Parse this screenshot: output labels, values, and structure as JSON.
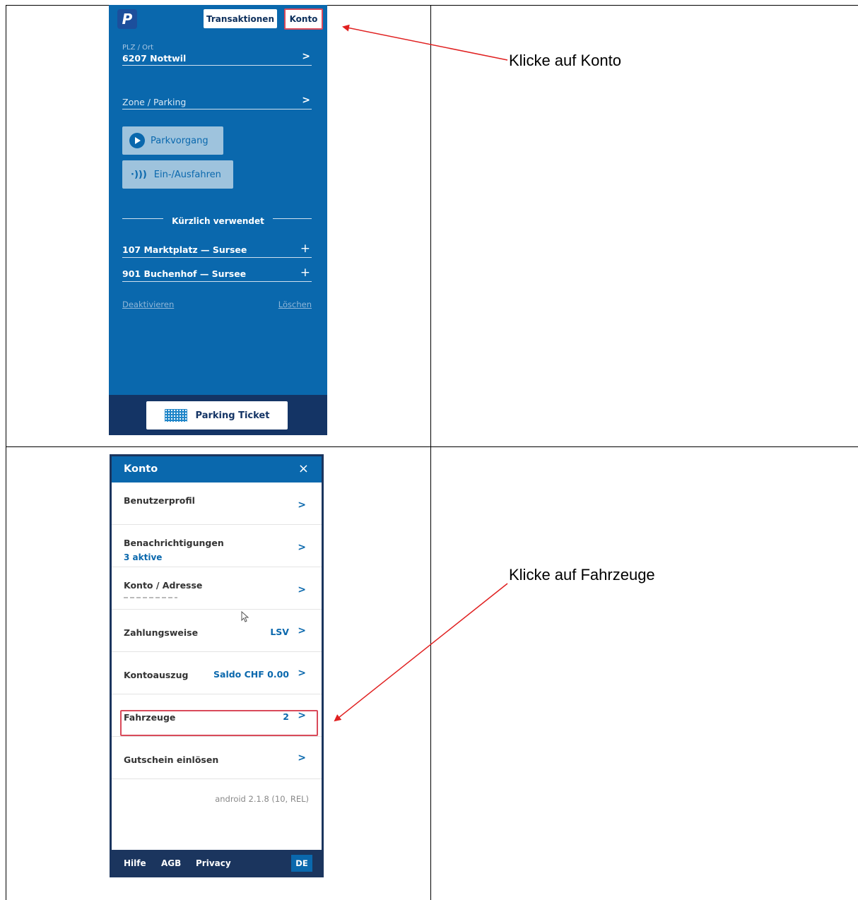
{
  "screen1": {
    "logo_letter": "P",
    "header": {
      "transactions_label": "Transaktionen",
      "account_label": "Konto"
    },
    "location": {
      "label": "PLZ / Ort",
      "value": "6207 Nottwil"
    },
    "zone": {
      "label": "Zone / Parking"
    },
    "actions": {
      "parking_label": "Parkvorgang",
      "entry_exit_label": "Ein-/Ausfahren"
    },
    "recent": {
      "title": "Kürzlich verwendet",
      "items": [
        {
          "label": "107 Marktplatz — Sursee"
        },
        {
          "label": "901 Buchenhof — Sursee"
        }
      ],
      "deactivate_label": "Deaktivieren",
      "delete_label": "Löschen"
    },
    "footer": {
      "ticket_label": "Parking Ticket"
    }
  },
  "screen2": {
    "title": "Konto",
    "close_icon": "×",
    "items": [
      {
        "label": "Benutzerprofil",
        "value": "",
        "sub": ""
      },
      {
        "label": "Benachrichtigungen",
        "value": "",
        "sub": "3 aktive"
      },
      {
        "label": "Konto / Adresse",
        "value": "",
        "sub": ""
      },
      {
        "label": "Zahlungsweise",
        "value": "LSV",
        "sub": ""
      },
      {
        "label": "Kontoauszug",
        "value": "Saldo CHF 0.00",
        "sub": ""
      },
      {
        "label": "Fahrzeuge",
        "value": "2",
        "sub": ""
      },
      {
        "label": "Gutschein einlösen",
        "value": "",
        "sub": ""
      }
    ],
    "version": "android 2.1.8 (10, REL)",
    "footer": {
      "help": "Hilfe",
      "terms": "AGB",
      "privacy": "Privacy",
      "language": "DE"
    }
  },
  "annotations": {
    "step1": "Klicke auf Konto",
    "step2": "Klicke auf Fahrzeuge",
    "arrow_color": "#e02020"
  },
  "colors": {
    "app_blue": "#0a68ad",
    "navy": "#143465",
    "highlight": "#d94a5a"
  }
}
